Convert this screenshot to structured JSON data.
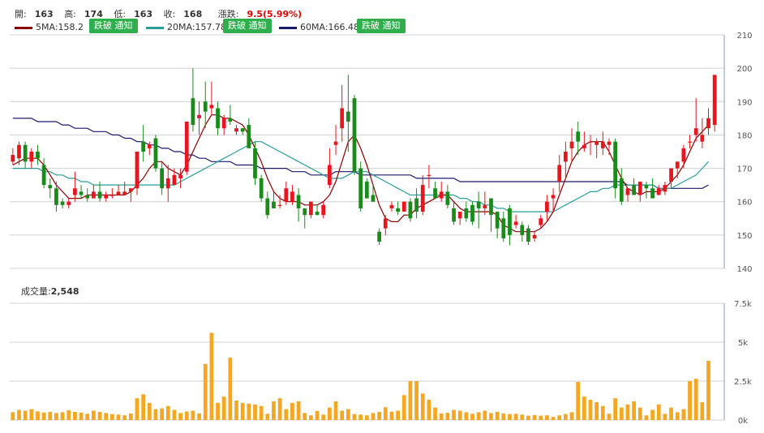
{
  "header": {
    "open_label": "開:",
    "open": "163",
    "high_label": "高:",
    "high": "174",
    "low_label": "低:",
    "low": "163",
    "close_label": "收:",
    "close": "168",
    "change_label": "漲跌:",
    "change": "9.5(5.99%)"
  },
  "ma_legend": [
    {
      "label": "5MA:158.2",
      "color": "#8b0000",
      "button": "跌破 通知"
    },
    {
      "label": "20MA:157.78",
      "color": "#2a9d9a",
      "button": "跌破 通知"
    },
    {
      "label": "60MA:166.48",
      "color": "#191970",
      "button": "跌破 通知"
    }
  ],
  "volume_label": {
    "prefix": "成交量:",
    "value": "2,548"
  },
  "colors": {
    "up": "#e8141e",
    "down": "#1a8a1a",
    "volume": "#f5a623",
    "grid": "#d0d0d0",
    "axis": "#8899bb"
  },
  "chart_data": [
    {
      "type": "candlestick",
      "title": "",
      "ylim": [
        140,
        210
      ],
      "yticks": [
        140,
        150,
        160,
        170,
        180,
        190,
        200,
        210
      ],
      "grid": true,
      "ohlc": [
        [
          172,
          176,
          171,
          174
        ],
        [
          173,
          178,
          171,
          177
        ],
        [
          177,
          178,
          170,
          172
        ],
        [
          172,
          176,
          170,
          175
        ],
        [
          175,
          177,
          171,
          173
        ],
        [
          171,
          173,
          164,
          165
        ],
        [
          165,
          167,
          161,
          164
        ],
        [
          164,
          166,
          157,
          159
        ],
        [
          160,
          161,
          158,
          159
        ],
        [
          159,
          161,
          158,
          160
        ],
        [
          162,
          169,
          160,
          164
        ],
        [
          163,
          165,
          161,
          162
        ],
        [
          162,
          164,
          160,
          161
        ],
        [
          161,
          165,
          161,
          163
        ],
        [
          163,
          166,
          160,
          161
        ],
        [
          161,
          163,
          160,
          162
        ],
        [
          162,
          164,
          161,
          162
        ],
        [
          162,
          165,
          162,
          163
        ],
        [
          162,
          166,
          162,
          163
        ],
        [
          163,
          164,
          160,
          164
        ],
        [
          164,
          175,
          162,
          175
        ],
        [
          178,
          183,
          172,
          175
        ],
        [
          176,
          178,
          174,
          177
        ],
        [
          179,
          180,
          169,
          170
        ],
        [
          170,
          172,
          162,
          164
        ],
        [
          164,
          171,
          160,
          167
        ],
        [
          165,
          170,
          165,
          168
        ],
        [
          167,
          170,
          164,
          168
        ],
        [
          169,
          182,
          168,
          184
        ],
        [
          191,
          200,
          181,
          183
        ],
        [
          185,
          190,
          180,
          186
        ],
        [
          190,
          196,
          182,
          187
        ],
        [
          188,
          196,
          186,
          189
        ],
        [
          188,
          190,
          180,
          182
        ],
        [
          182,
          186,
          180,
          185
        ],
        [
          185,
          189,
          183,
          184
        ],
        [
          181,
          183,
          180,
          182
        ],
        [
          182,
          182,
          180,
          181
        ],
        [
          183,
          185,
          177,
          176
        ],
        [
          176,
          178,
          165,
          167
        ],
        [
          167,
          168,
          160,
          161
        ],
        [
          161,
          163,
          155,
          156
        ],
        [
          160,
          163,
          158,
          158
        ],
        [
          159,
          162,
          158,
          159
        ],
        [
          160,
          166,
          159,
          164
        ],
        [
          160,
          165,
          159,
          163
        ],
        [
          162,
          164,
          154,
          158
        ],
        [
          158,
          158,
          152,
          156
        ],
        [
          156,
          160,
          155,
          160
        ],
        [
          157,
          159,
          156,
          156
        ],
        [
          156,
          160,
          155,
          159
        ],
        [
          165,
          176,
          164,
          171
        ],
        [
          177,
          183,
          174,
          178
        ],
        [
          182,
          195,
          178,
          188
        ],
        [
          187,
          198,
          175,
          184
        ],
        [
          191,
          192,
          168,
          169
        ],
        [
          170,
          172,
          157,
          158
        ],
        [
          166,
          167,
          161,
          161
        ],
        [
          162,
          165,
          160,
          160
        ],
        [
          151,
          152,
          147,
          148
        ],
        [
          152,
          156,
          150,
          155
        ],
        [
          158,
          160,
          157,
          159
        ],
        [
          158,
          160,
          156,
          157
        ],
        [
          157,
          160,
          157,
          160
        ],
        [
          160,
          161,
          154,
          155
        ],
        [
          161,
          164,
          155,
          157
        ],
        [
          157,
          168,
          156,
          165
        ],
        [
          168,
          171,
          164,
          168
        ],
        [
          164,
          166,
          161,
          161
        ],
        [
          161,
          166,
          160,
          163
        ],
        [
          163,
          165,
          158,
          159
        ],
        [
          158,
          160,
          153,
          154
        ],
        [
          155,
          157,
          153,
          157
        ],
        [
          158,
          160,
          154,
          155
        ],
        [
          159,
          160,
          153,
          154
        ],
        [
          160,
          163,
          152,
          158
        ],
        [
          158,
          163,
          156,
          159
        ],
        [
          161,
          161,
          151,
          156
        ],
        [
          157,
          157,
          149,
          152
        ],
        [
          155,
          157,
          148,
          149
        ],
        [
          158,
          159,
          147,
          150
        ],
        [
          153,
          156,
          152,
          154
        ],
        [
          153,
          154,
          148,
          150
        ],
        [
          152,
          153,
          147,
          148
        ],
        [
          149,
          151,
          148,
          150
        ],
        [
          153,
          156,
          152,
          155
        ],
        [
          157,
          162,
          154,
          160
        ],
        [
          161,
          164,
          157,
          162
        ],
        [
          166,
          174,
          163,
          171
        ],
        [
          172,
          178,
          167,
          175
        ],
        [
          176,
          182,
          172,
          178
        ],
        [
          181,
          184,
          174,
          178
        ],
        [
          176,
          181,
          175,
          177
        ],
        [
          178,
          180,
          174,
          178
        ],
        [
          177,
          179,
          173,
          178
        ],
        [
          176,
          181,
          174,
          178
        ],
        [
          177,
          179,
          174,
          178
        ],
        [
          178,
          179,
          161,
          164
        ],
        [
          167,
          170,
          159,
          160
        ],
        [
          162,
          162,
          160,
          164
        ],
        [
          165,
          167,
          162,
          162
        ],
        [
          162,
          166,
          160,
          166
        ],
        [
          165,
          166,
          161,
          164
        ],
        [
          164,
          167,
          161,
          161
        ],
        [
          162,
          165,
          162,
          164
        ],
        [
          163,
          166,
          162,
          165
        ],
        [
          166,
          167,
          164,
          170
        ],
        [
          170,
          172,
          167,
          172
        ],
        [
          172,
          177,
          170,
          176
        ],
        [
          178,
          180,
          176,
          178
        ],
        [
          180,
          191,
          178,
          182
        ],
        [
          178,
          185,
          176,
          180
        ],
        [
          182,
          188,
          180,
          185
        ],
        [
          183,
          198,
          181,
          198
        ]
      ],
      "ma5": [
        171,
        172,
        173,
        173,
        173,
        171,
        168,
        165,
        163,
        161,
        161,
        161,
        162,
        162,
        162,
        162,
        162,
        162,
        162,
        163,
        165,
        167,
        170,
        172,
        172,
        170,
        169,
        168,
        171,
        175,
        179,
        183,
        186,
        186,
        185,
        185,
        184,
        183,
        180,
        176,
        172,
        167,
        163,
        161,
        160,
        160,
        160,
        159,
        159,
        159,
        160,
        162,
        166,
        172,
        178,
        180,
        176,
        171,
        165,
        159,
        155,
        154,
        154,
        156,
        156,
        158,
        159,
        160,
        161,
        162,
        162,
        160,
        158,
        157,
        157,
        157,
        157,
        157,
        156,
        153,
        152,
        151,
        151,
        151,
        151,
        152,
        154,
        157,
        162,
        167,
        172,
        175,
        177,
        178,
        178,
        178,
        175,
        171,
        167,
        164,
        163,
        162,
        163,
        163,
        163,
        164,
        166,
        168,
        171,
        175,
        179,
        181,
        183
      ],
      "ma20": [
        170,
        170,
        170,
        170,
        170,
        169,
        169,
        168,
        168,
        167,
        167,
        166,
        166,
        165,
        165,
        165,
        165,
        165,
        165,
        165,
        165,
        165,
        165,
        165,
        165,
        165,
        165,
        166,
        167,
        168,
        169,
        170,
        171,
        172,
        173,
        174,
        175,
        176,
        177,
        178,
        178,
        177,
        176,
        175,
        174,
        173,
        172,
        171,
        170,
        169,
        168,
        167,
        167,
        167,
        168,
        169,
        169,
        169,
        168,
        167,
        166,
        165,
        164,
        163,
        162,
        162,
        162,
        162,
        162,
        162,
        162,
        162,
        161,
        161,
        160,
        160,
        159,
        159,
        158,
        158,
        157,
        157,
        157,
        157,
        157,
        157,
        157,
        157,
        158,
        159,
        160,
        161,
        162,
        163,
        163,
        164,
        164,
        165,
        165,
        165,
        165,
        165,
        165,
        165,
        164,
        164,
        164,
        165,
        166,
        167,
        168,
        170,
        172
      ],
      "ma60": [
        185,
        185,
        185,
        185,
        184,
        184,
        184,
        184,
        183,
        183,
        182,
        182,
        182,
        181,
        181,
        181,
        180,
        180,
        179,
        179,
        178,
        178,
        177,
        177,
        176,
        176,
        175,
        175,
        174,
        174,
        173,
        173,
        172,
        172,
        172,
        172,
        171,
        171,
        171,
        171,
        170,
        170,
        170,
        170,
        170,
        169,
        169,
        169,
        168,
        168,
        168,
        168,
        169,
        169,
        169,
        169,
        168,
        168,
        168,
        168,
        168,
        168,
        168,
        168,
        168,
        167,
        167,
        167,
        167,
        167,
        167,
        167,
        166,
        166,
        166,
        166,
        166,
        166,
        166,
        166,
        166,
        166,
        166,
        166,
        166,
        166,
        166,
        166,
        166,
        166,
        166,
        166,
        166,
        166,
        166,
        166,
        166,
        166,
        166,
        165,
        165,
        165,
        165,
        165,
        164,
        164,
        164,
        164,
        164,
        164,
        164,
        164,
        165
      ]
    },
    {
      "type": "bar",
      "title": "",
      "ylim": [
        0,
        7500
      ],
      "yticks": [
        "0k",
        "2.5k",
        "5k",
        "7.5k"
      ],
      "grid": true,
      "values": [
        500,
        650,
        600,
        700,
        550,
        480,
        520,
        450,
        500,
        620,
        520,
        480,
        400,
        600,
        520,
        450,
        380,
        350,
        300,
        420,
        1400,
        1650,
        1100,
        700,
        750,
        900,
        650,
        450,
        550,
        600,
        420,
        3600,
        5600,
        1100,
        1500,
        4000,
        1250,
        1100,
        1050,
        1000,
        900,
        400,
        1200,
        1400,
        700,
        1100,
        1200,
        450,
        300,
        580,
        350,
        800,
        1200,
        600,
        700,
        380,
        350,
        300,
        450,
        520,
        820,
        540,
        600,
        1600,
        2500,
        2500,
        1700,
        1300,
        800,
        420,
        460,
        650,
        600,
        500,
        400,
        500,
        600,
        450,
        520,
        420,
        380,
        400,
        350,
        280,
        320,
        280,
        300,
        200,
        300,
        380,
        500,
        2450,
        1500,
        1300,
        1150,
        900,
        400,
        1400,
        800,
        1000,
        1200,
        800,
        300,
        650,
        1000,
        400,
        800,
        500,
        700,
        2500,
        2650,
        1150,
        3800
      ]
    }
  ]
}
